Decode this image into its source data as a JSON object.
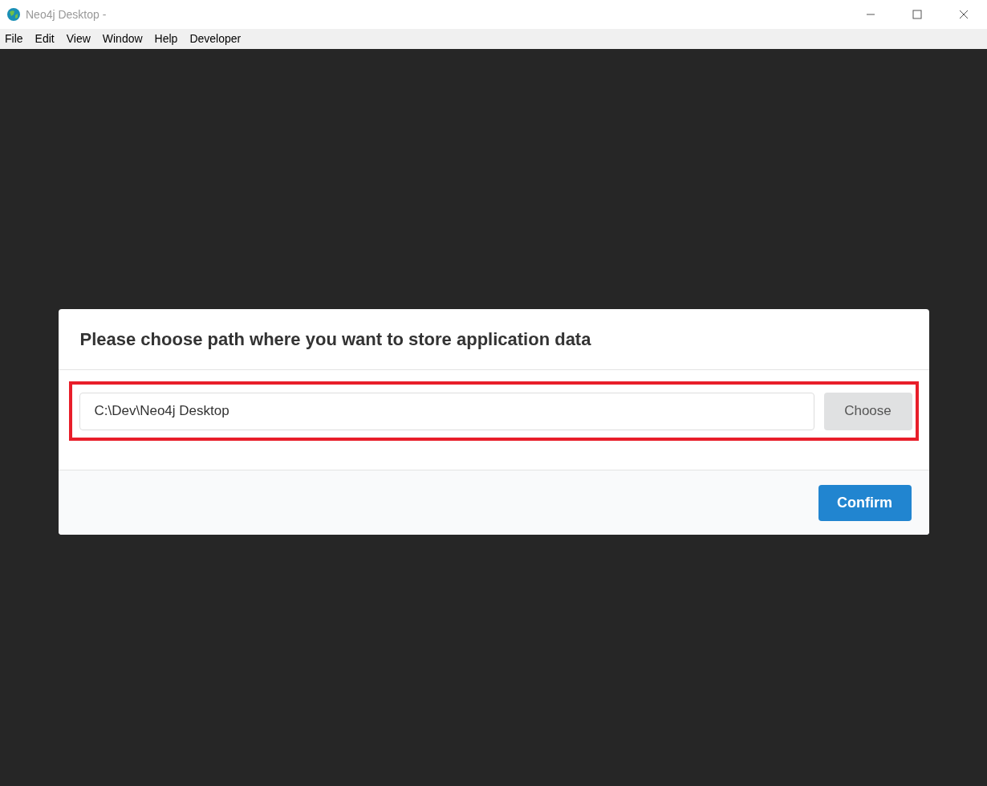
{
  "window": {
    "title": "Neo4j Desktop -"
  },
  "menu": [
    "File",
    "Edit",
    "View",
    "Window",
    "Help",
    "Developer"
  ],
  "dialog": {
    "title": "Please choose path where you want to store application data",
    "path_field": {
      "value": "C:\\Dev\\Neo4j Desktop"
    },
    "choose_button": "Choose",
    "confirm_button": "Confirm"
  }
}
